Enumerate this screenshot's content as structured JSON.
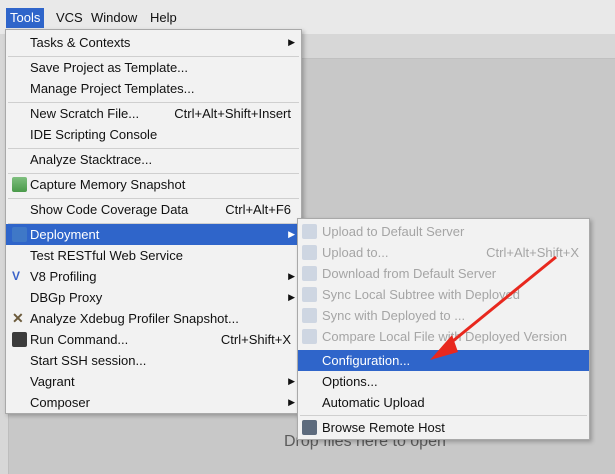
{
  "menubar": {
    "items": [
      {
        "label": "Tools",
        "underline": "T"
      },
      {
        "label": "VCS",
        "underline": "S"
      },
      {
        "label": "Window",
        "underline": "W"
      },
      {
        "label": "Help",
        "underline": "H"
      }
    ]
  },
  "tools_menu": {
    "items": [
      {
        "label": "Tasks & Contexts",
        "submenu": true
      },
      {
        "label": "Save Project as Template..."
      },
      {
        "label": "Manage Project Templates..."
      },
      {
        "label": "New Scratch File...",
        "shortcut": "Ctrl+Alt+Shift+Insert"
      },
      {
        "label": "IDE Scripting Console"
      },
      {
        "label": "Analyze Stacktrace..."
      },
      {
        "label": "Capture Memory Snapshot",
        "icon": "memory-snapshot-icon"
      },
      {
        "label": "Show Code Coverage Data",
        "shortcut": "Ctrl+Alt+F6"
      },
      {
        "label": "Deployment",
        "submenu": true,
        "icon": "deployment-icon",
        "selected": true
      },
      {
        "label": "Test RESTful Web Service"
      },
      {
        "label": "V8 Profiling",
        "submenu": true,
        "icon": "v8-icon"
      },
      {
        "label": "DBGp Proxy",
        "submenu": true
      },
      {
        "label": "Analyze Xdebug Profiler Snapshot...",
        "icon": "xdebug-icon"
      },
      {
        "label": "Run Command...",
        "shortcut": "Ctrl+Shift+X",
        "icon": "run-command-icon"
      },
      {
        "label": "Start SSH session..."
      },
      {
        "label": "Vagrant",
        "submenu": true
      },
      {
        "label": "Composer",
        "submenu": true
      }
    ]
  },
  "deployment_menu": {
    "items": [
      {
        "label": "Upload to Default Server",
        "disabled": true
      },
      {
        "label": "Upload to...",
        "shortcut": "Ctrl+Alt+Shift+X",
        "disabled": true
      },
      {
        "label": "Download from Default Server",
        "disabled": true
      },
      {
        "label": "Sync Local Subtree with Deployed",
        "disabled": true
      },
      {
        "label": "Sync with Deployed to ...",
        "disabled": true
      },
      {
        "label": "Compare Local File with Deployed Version",
        "disabled": true
      },
      {
        "label": "Configuration...",
        "selected": true
      },
      {
        "label": "Options..."
      },
      {
        "label": "Automatic Upload"
      },
      {
        "label": "Browse Remote Host",
        "icon": "browse-remote-icon"
      }
    ]
  },
  "editor": {
    "drop_hint": "Drop files here to open"
  },
  "colors": {
    "selection": "#2f65ca",
    "annotation_arrow": "#e8281e"
  }
}
